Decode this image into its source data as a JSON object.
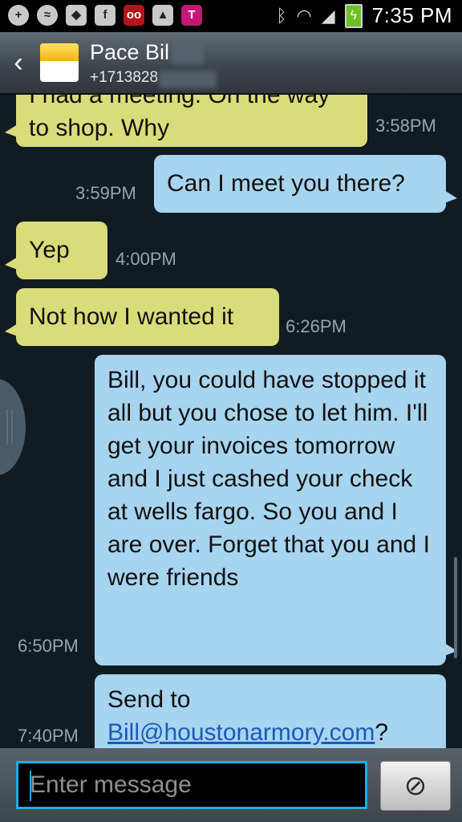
{
  "status_bar": {
    "time": "7:35 PM",
    "icons": [
      "plus-icon",
      "messenger-icon",
      "photos-icon",
      "facebook-icon",
      "voicemail-icon",
      "gallery-icon",
      "tmobile-icon",
      "bluetooth-icon",
      "wifi-icon",
      "signal-icon",
      "battery-icon"
    ]
  },
  "header": {
    "contact_name": "Pace Bil",
    "contact_number": "+1713828"
  },
  "messages": [
    {
      "direction": "in",
      "text": "I had a meeting. On the way to shop. Why",
      "time": "3:58PM"
    },
    {
      "direction": "out",
      "text": "Can I meet you there?",
      "time": "3:59PM"
    },
    {
      "direction": "in",
      "text": "Yep",
      "time": "4:00PM"
    },
    {
      "direction": "in",
      "text": "Not how I wanted it",
      "time": "6:26PM"
    },
    {
      "direction": "out",
      "text": "Bill, you could have stopped it all but you chose to let him. I'll get your invoices tomorrow and I just cashed your check at wells fargo. So you and I are over. Forget that you and I were friends",
      "time": "6:50PM"
    },
    {
      "direction": "out",
      "text_prefix": "Send to",
      "link": "Bill@houstonarmory.com",
      "text_suffix": "?",
      "time": "7:40PM"
    }
  ],
  "composer": {
    "placeholder": "Enter message",
    "attach_icon": "paperclip-icon"
  },
  "colors": {
    "incoming_bubble": "#d9dc7a",
    "outgoing_bubble": "#a7d4ef",
    "background": "#111b22",
    "input_border": "#2aa8e0"
  }
}
